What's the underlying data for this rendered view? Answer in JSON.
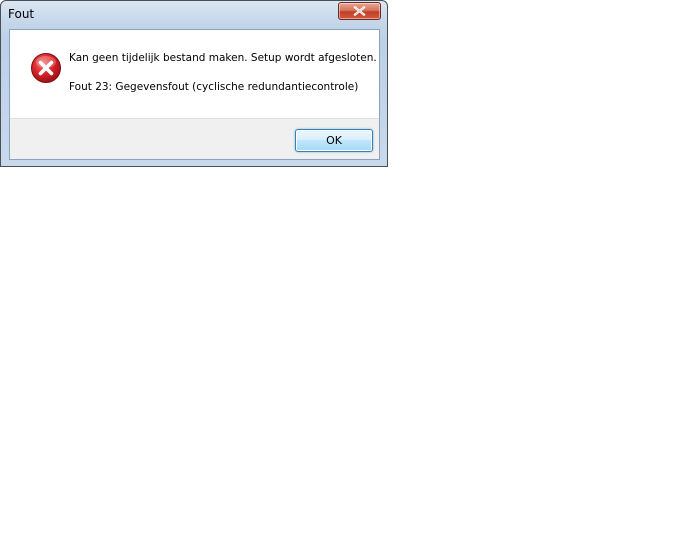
{
  "window": {
    "title": "Fout",
    "close_icon": "close-icon"
  },
  "content": {
    "icon": "error-icon",
    "message": "Kan geen tijdelijk bestand maken. Setup wordt afgesloten.",
    "detail": "Fout 23: Gegevensfout (cyclische redundantiecontrole)"
  },
  "buttons": {
    "ok_label": "OK"
  },
  "colors": {
    "error_red": "#d8242a",
    "close_red": "#c0402a",
    "button_focus": "#3c7fb1"
  }
}
